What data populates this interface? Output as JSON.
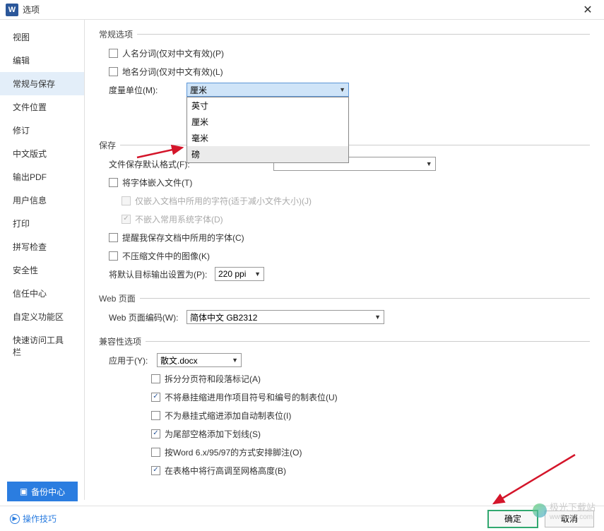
{
  "title": "选项",
  "app_icon_letter": "W",
  "sidebar": {
    "items": [
      {
        "label": "视图"
      },
      {
        "label": "编辑"
      },
      {
        "label": "常规与保存"
      },
      {
        "label": "文件位置"
      },
      {
        "label": "修订"
      },
      {
        "label": "中文版式"
      },
      {
        "label": "输出PDF"
      },
      {
        "label": "用户信息"
      },
      {
        "label": "打印"
      },
      {
        "label": "拼写检查"
      },
      {
        "label": "安全性"
      },
      {
        "label": "信任中心"
      },
      {
        "label": "自定义功能区"
      },
      {
        "label": "快速访问工具栏"
      }
    ],
    "selected_index": 2
  },
  "sections": {
    "general": {
      "title": "常规选项",
      "person_name_split": "人名分词(仅对中文有效)(P)",
      "place_name_split": "地名分词(仅对中文有效)(L)",
      "unit_label": "度量单位(M):",
      "unit_selected": "厘米",
      "unit_options": [
        "英寸",
        "厘米",
        "毫米",
        "磅"
      ]
    },
    "save": {
      "title": "保存",
      "default_format_label": "文件保存默认格式(F):",
      "embed_fonts": "将字体嵌入文件(T)",
      "embed_only_used": "仅嵌入文档中所用的字符(适于减小文件大小)(J)",
      "no_embed_system": "不嵌入常用系统字体(D)",
      "remind_fonts": "提醒我保存文档中所用的字体(C)",
      "no_compress_images": "不压缩文件中的图像(K)",
      "default_output_label": "将默认目标输出设置为(P):",
      "default_output_value": "220 ppi"
    },
    "web": {
      "title": "Web 页面",
      "encoding_label": "Web 页面编码(W):",
      "encoding_value": "简体中文 GB2312"
    },
    "compat": {
      "title": "兼容性选项",
      "apply_to_label": "应用于(Y):",
      "apply_to_value": "散文.docx",
      "opts": [
        {
          "label": "拆分分页符和段落标记(A)",
          "checked": false
        },
        {
          "label": "不将悬挂缩进用作项目符号和编号的制表位(U)",
          "checked": true
        },
        {
          "label": "不为悬挂式缩进添加自动制表位(I)",
          "checked": false
        },
        {
          "label": "为尾部空格添加下划线(S)",
          "checked": true
        },
        {
          "label": "按Word 6.x/95/97的方式安排脚注(O)",
          "checked": false
        },
        {
          "label": "在表格中将行高调至网格高度(B)",
          "checked": true
        }
      ]
    }
  },
  "backup_center": "备份中心",
  "tips_link": "操作技巧",
  "buttons": {
    "ok": "确定",
    "cancel": "取消"
  },
  "watermark": {
    "text": "极光下载站",
    "url": "www.xz7.com"
  }
}
